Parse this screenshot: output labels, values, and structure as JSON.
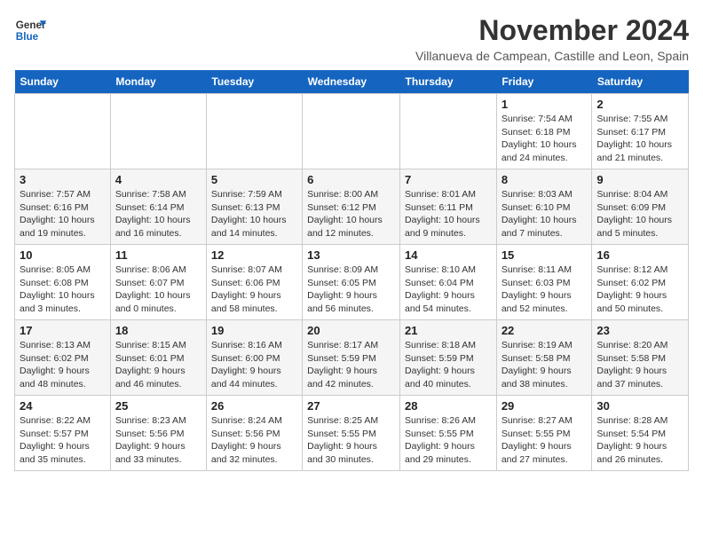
{
  "logo": {
    "line1": "General",
    "line2": "Blue"
  },
  "title": "November 2024",
  "subtitle": "Villanueva de Campean, Castille and Leon, Spain",
  "days_header": [
    "Sunday",
    "Monday",
    "Tuesday",
    "Wednesday",
    "Thursday",
    "Friday",
    "Saturday"
  ],
  "weeks": [
    [
      {
        "day": "",
        "info": ""
      },
      {
        "day": "",
        "info": ""
      },
      {
        "day": "",
        "info": ""
      },
      {
        "day": "",
        "info": ""
      },
      {
        "day": "",
        "info": ""
      },
      {
        "day": "1",
        "info": "Sunrise: 7:54 AM\nSunset: 6:18 PM\nDaylight: 10 hours and 24 minutes."
      },
      {
        "day": "2",
        "info": "Sunrise: 7:55 AM\nSunset: 6:17 PM\nDaylight: 10 hours and 21 minutes."
      }
    ],
    [
      {
        "day": "3",
        "info": "Sunrise: 7:57 AM\nSunset: 6:16 PM\nDaylight: 10 hours and 19 minutes."
      },
      {
        "day": "4",
        "info": "Sunrise: 7:58 AM\nSunset: 6:14 PM\nDaylight: 10 hours and 16 minutes."
      },
      {
        "day": "5",
        "info": "Sunrise: 7:59 AM\nSunset: 6:13 PM\nDaylight: 10 hours and 14 minutes."
      },
      {
        "day": "6",
        "info": "Sunrise: 8:00 AM\nSunset: 6:12 PM\nDaylight: 10 hours and 12 minutes."
      },
      {
        "day": "7",
        "info": "Sunrise: 8:01 AM\nSunset: 6:11 PM\nDaylight: 10 hours and 9 minutes."
      },
      {
        "day": "8",
        "info": "Sunrise: 8:03 AM\nSunset: 6:10 PM\nDaylight: 10 hours and 7 minutes."
      },
      {
        "day": "9",
        "info": "Sunrise: 8:04 AM\nSunset: 6:09 PM\nDaylight: 10 hours and 5 minutes."
      }
    ],
    [
      {
        "day": "10",
        "info": "Sunrise: 8:05 AM\nSunset: 6:08 PM\nDaylight: 10 hours and 3 minutes."
      },
      {
        "day": "11",
        "info": "Sunrise: 8:06 AM\nSunset: 6:07 PM\nDaylight: 10 hours and 0 minutes."
      },
      {
        "day": "12",
        "info": "Sunrise: 8:07 AM\nSunset: 6:06 PM\nDaylight: 9 hours and 58 minutes."
      },
      {
        "day": "13",
        "info": "Sunrise: 8:09 AM\nSunset: 6:05 PM\nDaylight: 9 hours and 56 minutes."
      },
      {
        "day": "14",
        "info": "Sunrise: 8:10 AM\nSunset: 6:04 PM\nDaylight: 9 hours and 54 minutes."
      },
      {
        "day": "15",
        "info": "Sunrise: 8:11 AM\nSunset: 6:03 PM\nDaylight: 9 hours and 52 minutes."
      },
      {
        "day": "16",
        "info": "Sunrise: 8:12 AM\nSunset: 6:02 PM\nDaylight: 9 hours and 50 minutes."
      }
    ],
    [
      {
        "day": "17",
        "info": "Sunrise: 8:13 AM\nSunset: 6:02 PM\nDaylight: 9 hours and 48 minutes."
      },
      {
        "day": "18",
        "info": "Sunrise: 8:15 AM\nSunset: 6:01 PM\nDaylight: 9 hours and 46 minutes."
      },
      {
        "day": "19",
        "info": "Sunrise: 8:16 AM\nSunset: 6:00 PM\nDaylight: 9 hours and 44 minutes."
      },
      {
        "day": "20",
        "info": "Sunrise: 8:17 AM\nSunset: 5:59 PM\nDaylight: 9 hours and 42 minutes."
      },
      {
        "day": "21",
        "info": "Sunrise: 8:18 AM\nSunset: 5:59 PM\nDaylight: 9 hours and 40 minutes."
      },
      {
        "day": "22",
        "info": "Sunrise: 8:19 AM\nSunset: 5:58 PM\nDaylight: 9 hours and 38 minutes."
      },
      {
        "day": "23",
        "info": "Sunrise: 8:20 AM\nSunset: 5:58 PM\nDaylight: 9 hours and 37 minutes."
      }
    ],
    [
      {
        "day": "24",
        "info": "Sunrise: 8:22 AM\nSunset: 5:57 PM\nDaylight: 9 hours and 35 minutes."
      },
      {
        "day": "25",
        "info": "Sunrise: 8:23 AM\nSunset: 5:56 PM\nDaylight: 9 hours and 33 minutes."
      },
      {
        "day": "26",
        "info": "Sunrise: 8:24 AM\nSunset: 5:56 PM\nDaylight: 9 hours and 32 minutes."
      },
      {
        "day": "27",
        "info": "Sunrise: 8:25 AM\nSunset: 5:55 PM\nDaylight: 9 hours and 30 minutes."
      },
      {
        "day": "28",
        "info": "Sunrise: 8:26 AM\nSunset: 5:55 PM\nDaylight: 9 hours and 29 minutes."
      },
      {
        "day": "29",
        "info": "Sunrise: 8:27 AM\nSunset: 5:55 PM\nDaylight: 9 hours and 27 minutes."
      },
      {
        "day": "30",
        "info": "Sunrise: 8:28 AM\nSunset: 5:54 PM\nDaylight: 9 hours and 26 minutes."
      }
    ]
  ]
}
